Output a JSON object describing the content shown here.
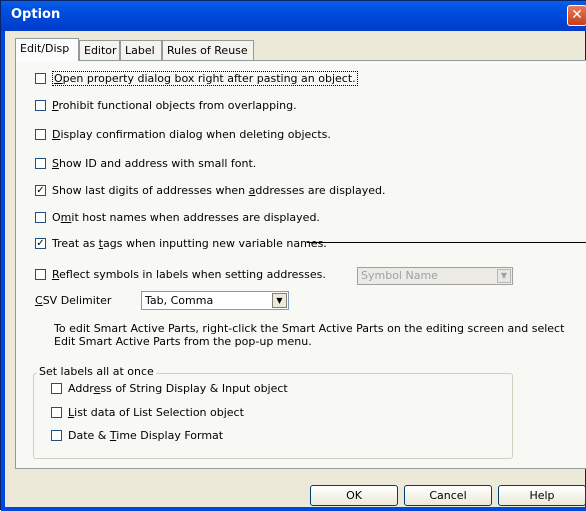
{
  "window": {
    "title": "Option",
    "close_glyph": "✕"
  },
  "tabs": [
    {
      "label": "Edit/Disp",
      "active": true
    },
    {
      "label": "Editor",
      "active": false
    },
    {
      "label": "Label",
      "active": false
    },
    {
      "label": "Rules of Reuse",
      "active": false
    }
  ],
  "options": [
    {
      "prefix": "",
      "key": "O",
      "rest": "pen property dialog box right after pasting an object.",
      "checked": false
    },
    {
      "prefix": "",
      "key": "P",
      "rest": "rohibit functional objects from overlapping.",
      "checked": false
    },
    {
      "prefix": "",
      "key": "D",
      "rest": "isplay confirmation dialog when deleting objects.",
      "checked": false
    },
    {
      "prefix": "",
      "key": "S",
      "rest": "how ID and address with small font.",
      "checked": false
    },
    {
      "prefix": "Show last digits of addresses when ",
      "key": "a",
      "rest": "ddresses are displayed.",
      "checked": true
    },
    {
      "prefix": "O",
      "key": "m",
      "rest": "it host names when addresses are displayed.",
      "checked": false
    },
    {
      "prefix": "Treat as ",
      "key": "t",
      "rest": "ags when inputting new variable names.",
      "checked": true
    },
    {
      "prefix": "",
      "key": "R",
      "rest": "eflect symbols in labels when setting addresses.",
      "checked": false
    }
  ],
  "check_glyph": "✓",
  "symbol_select": {
    "value": "Symbol Name",
    "arrow": "▼"
  },
  "csv": {
    "key": "C",
    "rest": "SV Delimiter",
    "value": "Tab, Comma",
    "arrow": "▼"
  },
  "info_text_line1": "To edit Smart Active Parts, right-click the Smart Active Parts on the editing screen and select",
  "info_text_line2": "Edit Smart Active Parts from the pop-up menu.",
  "group": {
    "title": "Set labels all at once",
    "items": [
      {
        "prefix": "Addr",
        "key": "e",
        "rest": "ss of String Display & Input object",
        "checked": false
      },
      {
        "prefix": "",
        "key": "L",
        "rest": "ist data of List Selection object",
        "checked": false
      },
      {
        "prefix": "Date & ",
        "key": "T",
        "rest": "ime Display Format",
        "checked": false
      }
    ]
  },
  "buttons": {
    "ok": "OK",
    "cancel": "Cancel",
    "help": "Help"
  }
}
